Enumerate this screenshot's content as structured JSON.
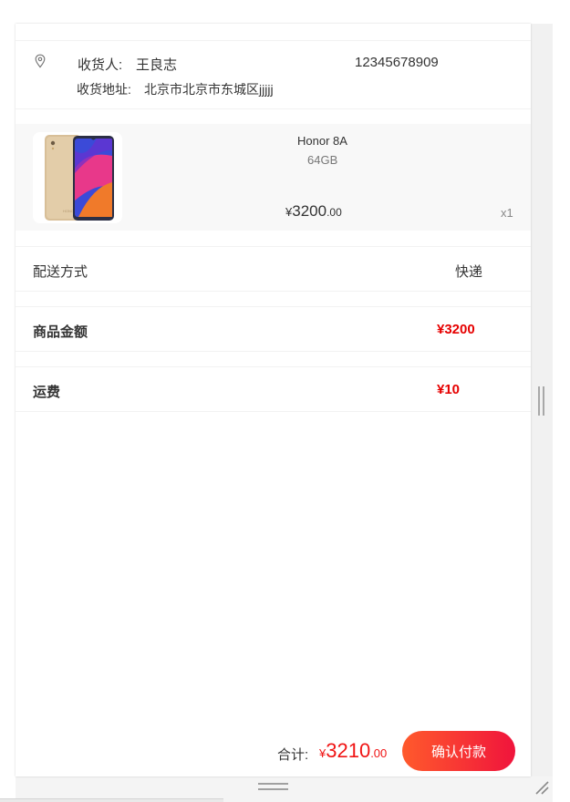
{
  "address": {
    "icon": "location-pin-icon",
    "receiver_label": "收货人:",
    "receiver_name": "王良志",
    "phone": "12345678909",
    "address_label": "收货地址:",
    "address_text": "北京市北京市东城区jjjjj"
  },
  "product": {
    "image": "honor-phone-image",
    "name": "Honor 8A",
    "spec": "64GB",
    "price_symbol": "¥",
    "price_int": "3200",
    "price_dec": ".00",
    "quantity": "x1"
  },
  "delivery": {
    "label": "配送方式",
    "value": "快递"
  },
  "goods_amount": {
    "label": "商品金额",
    "value": "¥3200"
  },
  "shipping_fee": {
    "label": "运费",
    "value": "¥10"
  },
  "footer": {
    "total_label": "合计:",
    "total_symbol": "¥",
    "total_int": "3210",
    "total_dec": ".00",
    "pay_button": "确认付款"
  },
  "colors": {
    "accent_red": "#e60000",
    "button_start": "#ff5a2c",
    "button_end": "#f0143c"
  }
}
